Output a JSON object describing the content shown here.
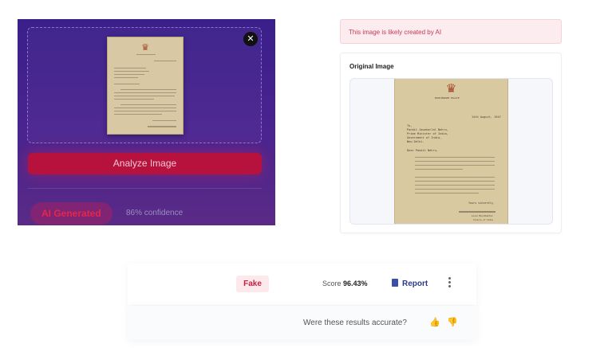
{
  "analyzer": {
    "analyze_button_label": "Analyze Image",
    "verdict_label": "AI Generated",
    "confidence_text": "86% confidence",
    "close_icon": "close-icon"
  },
  "alert": {
    "message": "This image is likely created by AI"
  },
  "original": {
    "title": "Original Image"
  },
  "letter": {
    "heading": "BUCKINGHAM PALACE",
    "date": "14th August, 1947",
    "to_lines": [
      "To,",
      "Pandit Jawaharlal Nehru,",
      "Prime Minister of India,",
      "Government of India,",
      "New Delhi."
    ],
    "salutation": "Dear Pandit Nehru,",
    "closing": "Yours sincerely,",
    "sign_name": "Louis Mountbatten",
    "sign_title": "Viceroy of India"
  },
  "result": {
    "badge": "Fake",
    "score_label": "Score",
    "score_value": "96.43%",
    "report_label": "Report"
  },
  "feedback": {
    "question": "Were these results accurate?"
  },
  "colors": {
    "accent_red": "#c4213f",
    "panel_purple": "#3a1f8a",
    "report_blue": "#2a3b86"
  }
}
